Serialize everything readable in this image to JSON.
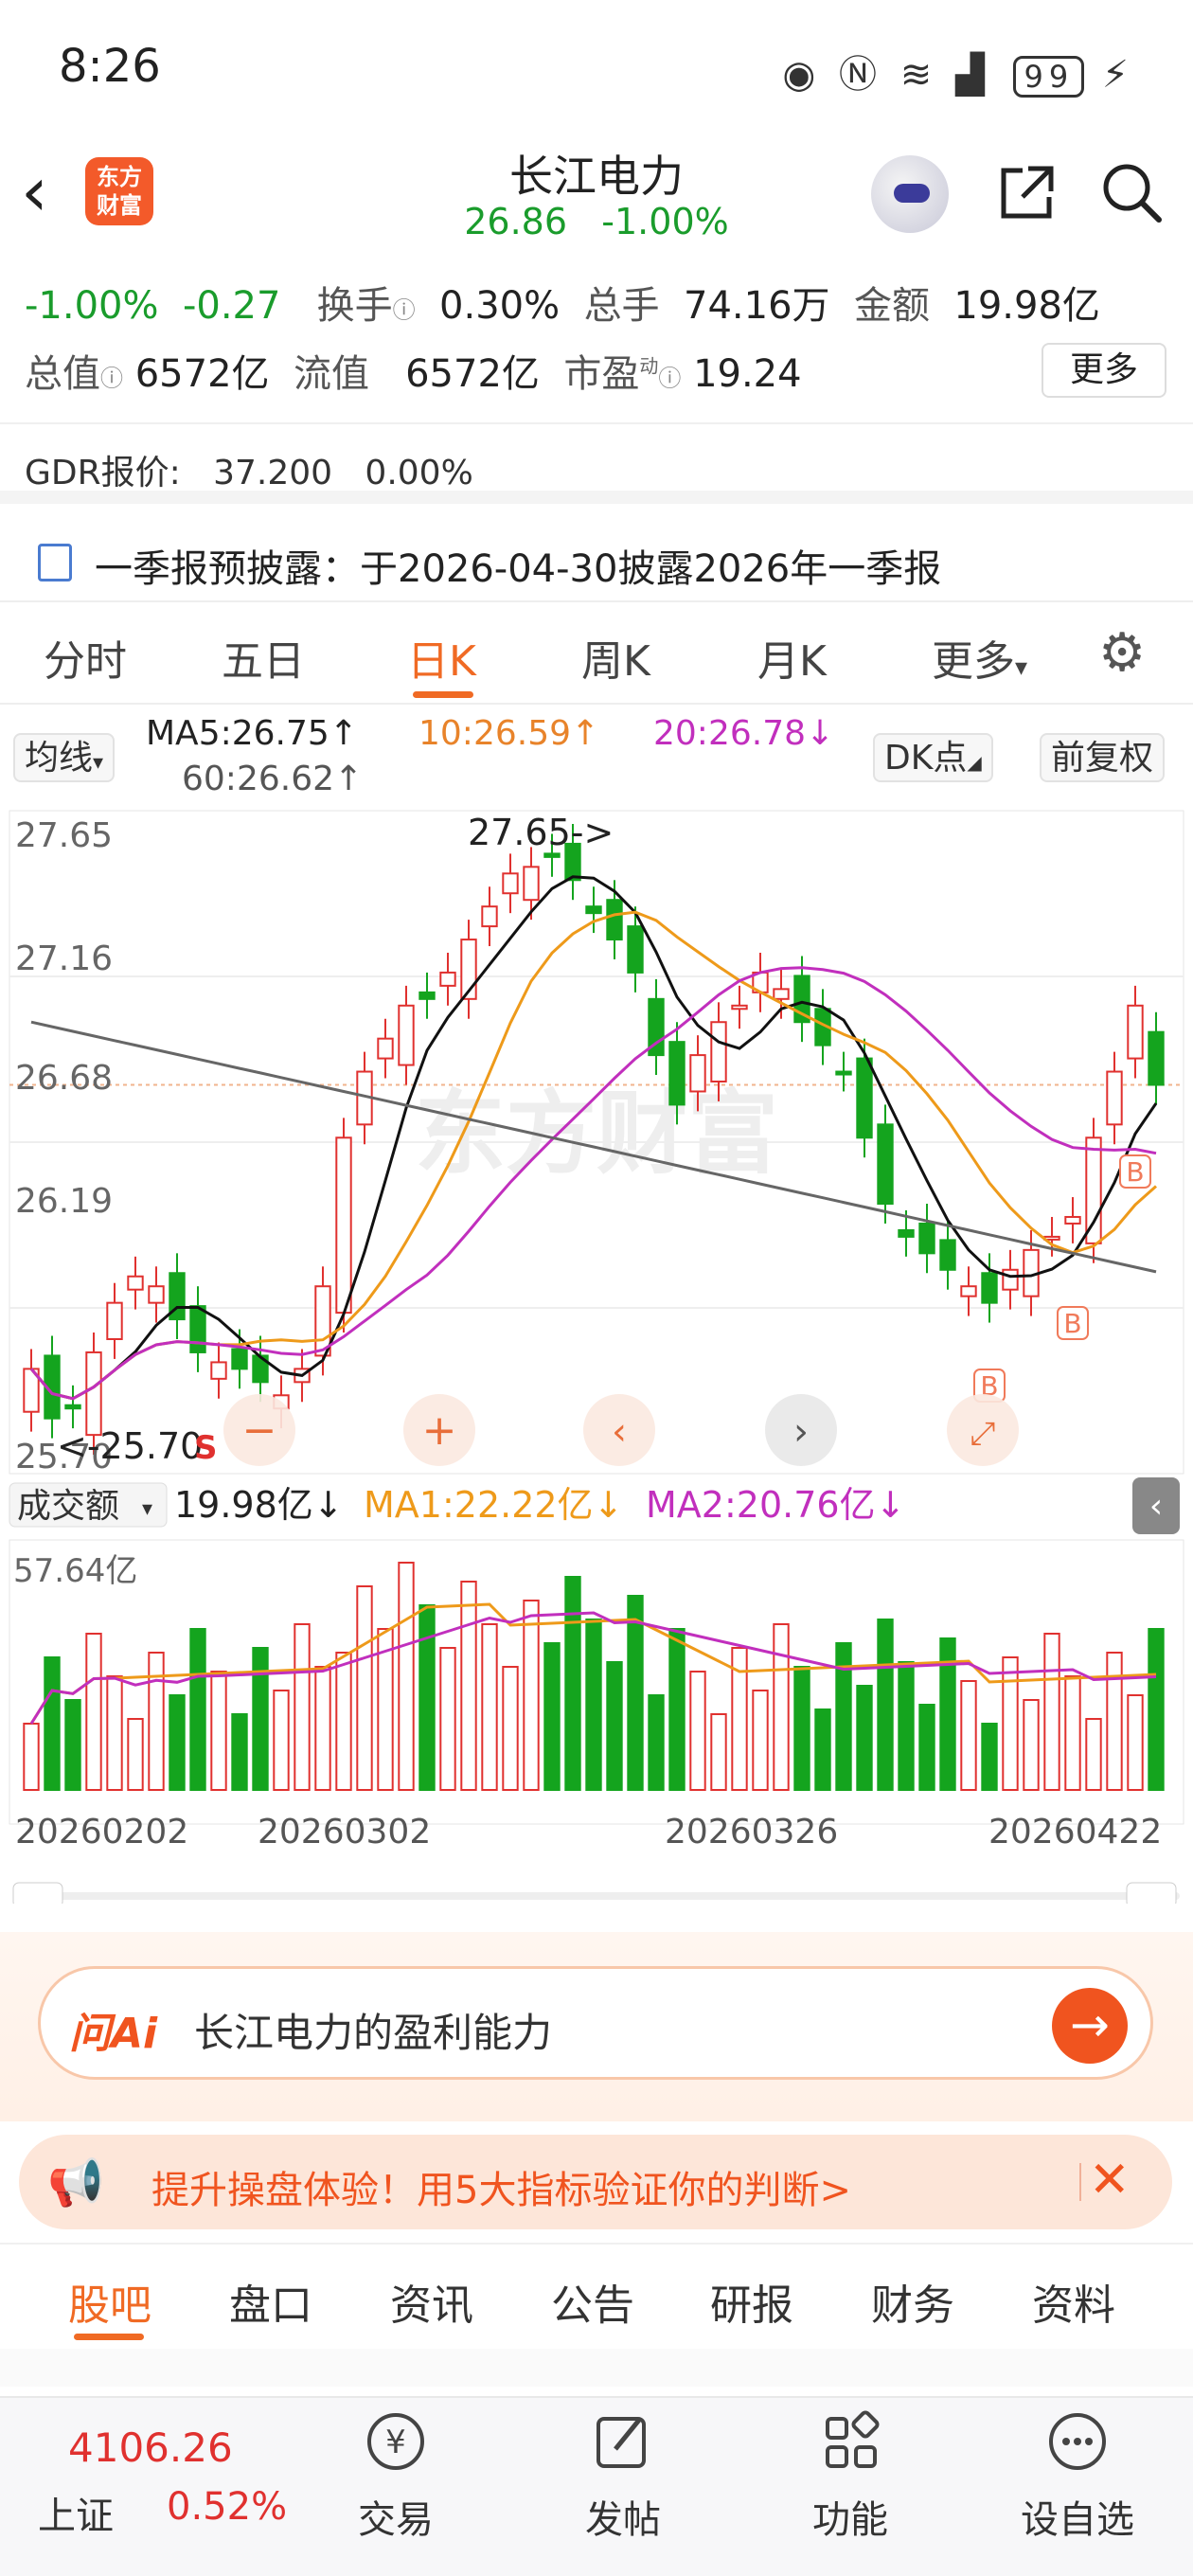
{
  "status_bar": {
    "time": "8:26",
    "battery": "99"
  },
  "header": {
    "logo_line1": "东方",
    "logo_line2": "财富",
    "stock_name": "长江电力",
    "price": "26.86",
    "change_pct": "-1.00%"
  },
  "quote": {
    "change_pct": "-1.00%",
    "change": "-0.27",
    "turnover_label": "换手",
    "turnover": "0.30%",
    "volume_label": "总手",
    "volume": "74.16万",
    "amount_label": "金额",
    "amount": "19.98亿",
    "total_cap_label": "总值",
    "total_cap": "6572亿",
    "float_cap_label": "流值",
    "float_cap": "6572亿",
    "pe_label": "市盈",
    "pe_sup": "动",
    "pe": "19.24",
    "more": "更多"
  },
  "gdr": {
    "label": "GDR报价:",
    "price": "37.200",
    "change": "0.00%"
  },
  "report": {
    "text": "一季报预披露：于2026-04-30披露2026年一季报"
  },
  "kline_tabs": [
    "分时",
    "五日",
    "日K",
    "周K",
    "月K",
    "更多"
  ],
  "indicators": {
    "ma_selector": "均线",
    "ma5": "MA5:26.75↑",
    "ma10": "10:26.59↑",
    "ma20": "20:26.78↓",
    "ma60": "60:26.62↑",
    "dk": "DK点",
    "adjust": "前复权"
  },
  "chart_data": {
    "type": "candlestick",
    "price_axis": [
      "27.65",
      "27.16",
      "26.68",
      "26.19",
      "25.70"
    ],
    "ylim": [
      25.7,
      27.65
    ],
    "max_label": "27.65->",
    "min_label": "<-25.70",
    "volume_selector": "成交额",
    "volume_value": "19.98亿↓",
    "vol_ma1": "MA1:22.22亿↓",
    "vol_ma2": "MA2:20.76亿↓",
    "volume_max_label": "57.64亿",
    "date_labels": [
      "20260202",
      "20260302",
      "20260326",
      "20260422"
    ],
    "markers": [
      "B",
      "B",
      "B",
      "S"
    ],
    "colors": {
      "up": "#e0312f",
      "down": "#14a41e",
      "ma5": "#111111",
      "ma10": "#ee9a1a",
      "ma20": "#c12fbd",
      "ma60": "#666666"
    }
  },
  "ai": {
    "logo": "问Ai",
    "query": "长江电力的盈利能力"
  },
  "promo": {
    "text": "提升操盘体验！用5大指标验证你的判断>"
  },
  "bottom_tabs": [
    "股吧",
    "盘口",
    "资讯",
    "公告",
    "研报",
    "财务",
    "资料"
  ],
  "bottom_nav": {
    "index_value": "4106.26",
    "index_name": "上证",
    "index_change": "0.52%",
    "items": [
      "交易",
      "发帖",
      "功能",
      "设自选"
    ]
  }
}
